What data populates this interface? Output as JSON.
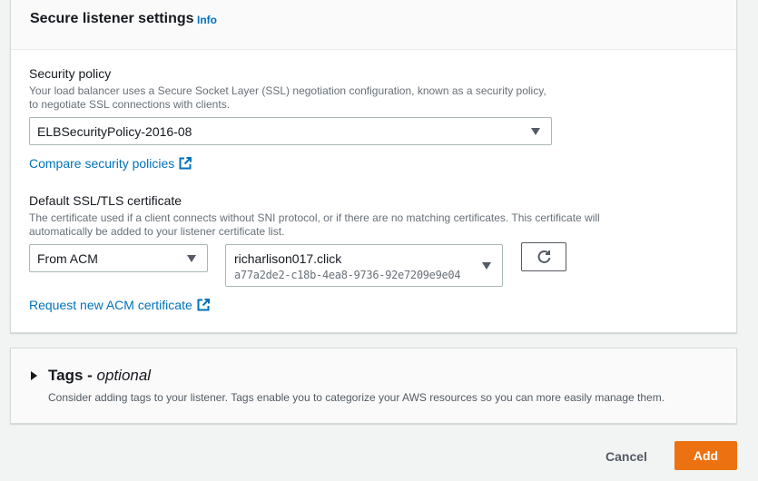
{
  "listener_settings": {
    "title": "Secure listener settings",
    "info_label": "Info",
    "security_policy": {
      "label": "Security policy",
      "description": "Your load balancer uses a Secure Socket Layer (SSL) negotiation configuration, known as a security policy, to negotiate SSL connections with clients.",
      "selected_value": "ELBSecurityPolicy-2016-08",
      "compare_link": "Compare security policies"
    },
    "certificate": {
      "label": "Default SSL/TLS certificate",
      "description": "The certificate used if a client connects without SNI protocol, or if there are no matching certificates. This certificate will automatically be added to your listener certificate list.",
      "source_value": "From ACM",
      "cert_name": "richarlison017.click",
      "cert_id": "a77a2de2-c18b-4ea8-9736-92e7209e9e04",
      "refresh_icon": "refresh-icon",
      "request_link": "Request new ACM certificate"
    }
  },
  "tags": {
    "title": "Tags - ",
    "optional": "optional",
    "description": "Consider adding tags to your listener. Tags enable you to categorize your AWS resources so you can more easily manage them."
  },
  "footer": {
    "cancel_label": "Cancel",
    "add_label": "Add"
  },
  "colors": {
    "link": "#0073bb",
    "primary_button": "#ec7211",
    "page_background": "#f2f3f3"
  }
}
